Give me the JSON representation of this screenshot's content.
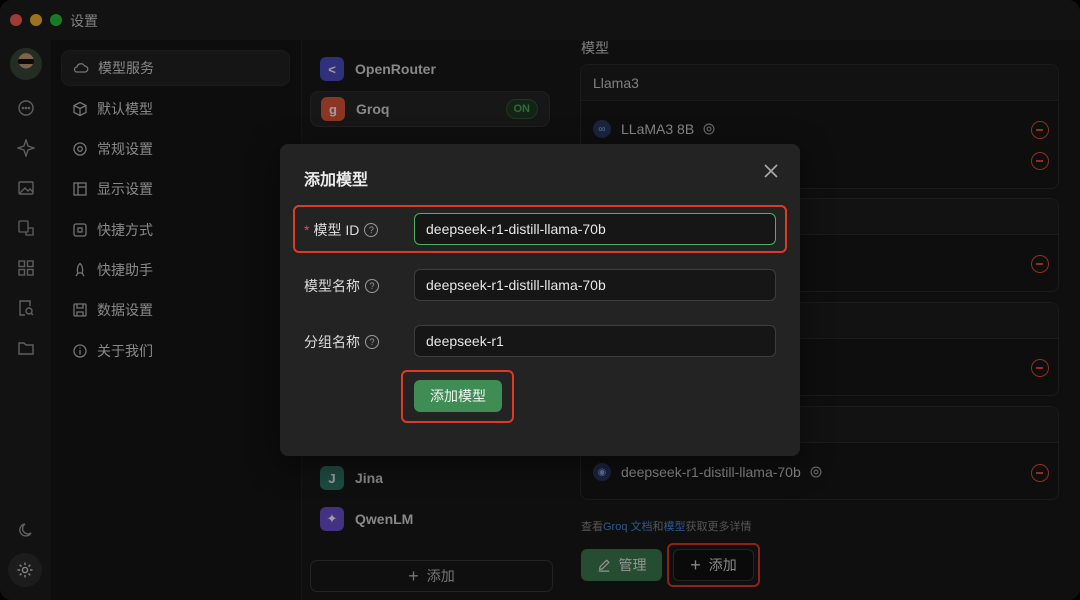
{
  "window": {
    "title": "设置"
  },
  "menu": {
    "items": [
      {
        "label": "模型服务",
        "icon": "cloud-icon",
        "active": true
      },
      {
        "label": "默认模型",
        "icon": "cube-icon"
      },
      {
        "label": "常规设置",
        "icon": "gear-icon"
      },
      {
        "label": "显示设置",
        "icon": "layout-icon"
      },
      {
        "label": "快捷方式",
        "icon": "command-icon"
      },
      {
        "label": "快捷助手",
        "icon": "rocket-icon"
      },
      {
        "label": "数据设置",
        "icon": "save-icon"
      },
      {
        "label": "关于我们",
        "icon": "info-icon"
      }
    ]
  },
  "providers": {
    "items": [
      {
        "name": "OpenRouter",
        "logo": "<",
        "color": "#5b5fd6"
      },
      {
        "name": "Groq",
        "logo": "g",
        "color": "#e0573c",
        "active": true,
        "status": "ON"
      },
      {
        "name": "Jina",
        "logo": "J",
        "color": "#2f7a69"
      },
      {
        "name": "QwenLM",
        "logo": "✦",
        "color": "#6c4fd6"
      }
    ],
    "add_label": "添加"
  },
  "models": {
    "section_label": "模型",
    "groups": [
      {
        "name": "Llama3",
        "models": [
          "LLaMA3 8B"
        ]
      },
      {
        "name": "",
        "models": [
          "deepseek-r1-distill-llama-70b"
        ]
      }
    ],
    "hint": {
      "prefix": "查看",
      "link1": "Groq 文档",
      "mid": "和",
      "link2": "模型",
      "suffix": "获取更多详情"
    },
    "manage_label": "管理",
    "add_label": "添加"
  },
  "dialog": {
    "title": "添加模型",
    "fields": {
      "model_id": {
        "label": "模型 ID",
        "required_mark": "*",
        "value": "deepseek-r1-distill-llama-70b"
      },
      "model_name": {
        "label": "模型名称",
        "value": "deepseek-r1-distill-llama-70b"
      },
      "group_name": {
        "label": "分组名称",
        "value": "deepseek-r1"
      }
    },
    "submit_label": "添加模型",
    "help_glyph": "?"
  },
  "colors": {
    "accent": "#3f8c55",
    "highlight": "#e03a22",
    "danger": "#e0503a"
  }
}
